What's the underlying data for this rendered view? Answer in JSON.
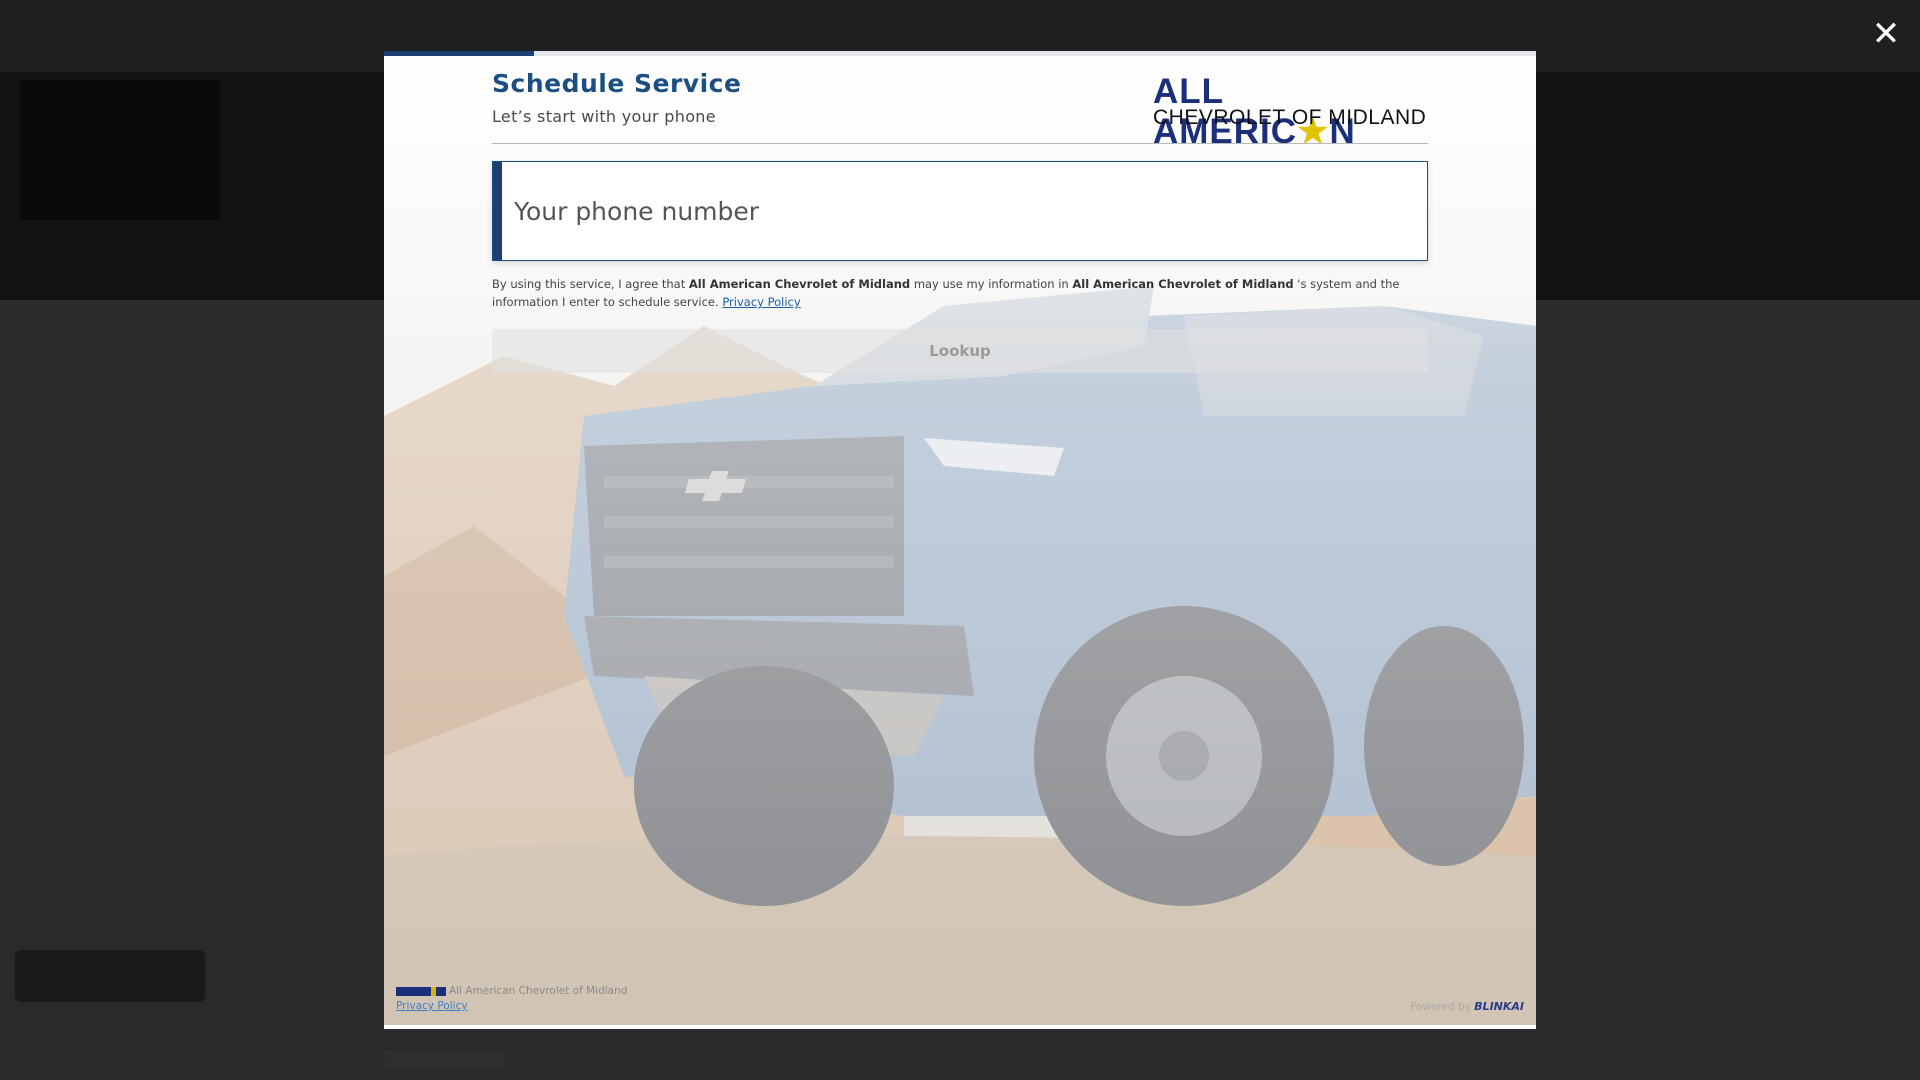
{
  "modal": {
    "title": "Schedule Service",
    "subtitle": "Let’s start with your phone",
    "progress_fraction": 0.13,
    "close_icon": "close-icon",
    "colors": {
      "accent": "#1b3f72",
      "title": "#1b4f82",
      "link": "#1b5fa8"
    }
  },
  "dealer": {
    "logo_line1": "ALL AMERIC",
    "logo_star": "★",
    "logo_line1_end": "N",
    "logo_line2": "CHEVROLET OF MIDLAND"
  },
  "phone": {
    "placeholder": "Your phone number",
    "value": ""
  },
  "consent": {
    "prefix": "By using this service, I agree that",
    "dealer_name_1": "All American Chevrolet of Midland",
    "middle": "may use my information in",
    "dealer_name_2": "All American Chevrolet of Midland",
    "suffix": "'s system and the information I enter to schedule service.",
    "privacy_link": "Privacy Policy"
  },
  "lookup_button": "Lookup",
  "footer": {
    "dealer_name": "All American Chevrolet of Midland",
    "privacy_link": "Privacy Policy",
    "powered_by": "Powered by",
    "powered_brand": "BLINKAI"
  }
}
